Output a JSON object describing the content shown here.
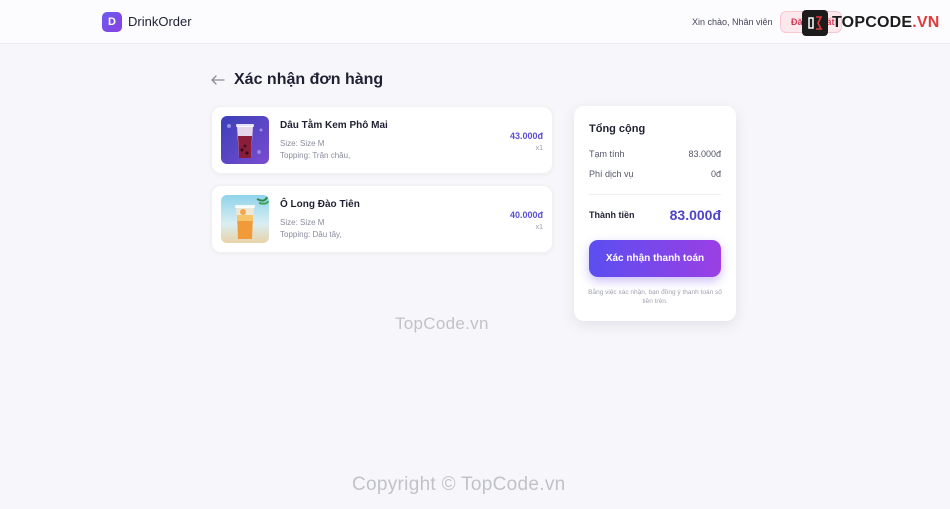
{
  "header": {
    "logo_letter": "D",
    "brand": "DrinkOrder",
    "greeting": "Xin chào, Nhân viên",
    "logout_label": "Đăng xuất",
    "accent": "#6a5cf0"
  },
  "watermark_logo": {
    "prefix": "TOPCODE",
    "suffix": ".VN"
  },
  "page": {
    "back_icon": "arrow-left-icon",
    "title": "Xác nhận đơn hàng"
  },
  "items": [
    {
      "name": "Dâu Tằm Kem Phô Mai",
      "size": "Size: Size M",
      "topping": "Topping: Trân châu,",
      "price": "43.000đ",
      "qty": "x1"
    },
    {
      "name": "Ô Long Đào Tiên",
      "size": "Size: Size M",
      "topping": "Topping: Dâu tây,",
      "price": "40.000đ",
      "qty": "x1"
    }
  ],
  "summary": {
    "title": "Tổng cộng",
    "subtotal_label": "Tạm tính",
    "subtotal_value": "83.000đ",
    "service_label": "Phí dịch vụ",
    "service_value": "0đ",
    "total_label": "Thành tiền",
    "total_value": "83.000đ",
    "confirm_label": "Xác nhận thanh toán",
    "note": "Bằng việc xác nhận, bạn đồng ý thanh toán số tiền trên."
  },
  "watermarks": {
    "center": "TopCode.vn",
    "bottom": "Copyright © TopCode.vn"
  }
}
